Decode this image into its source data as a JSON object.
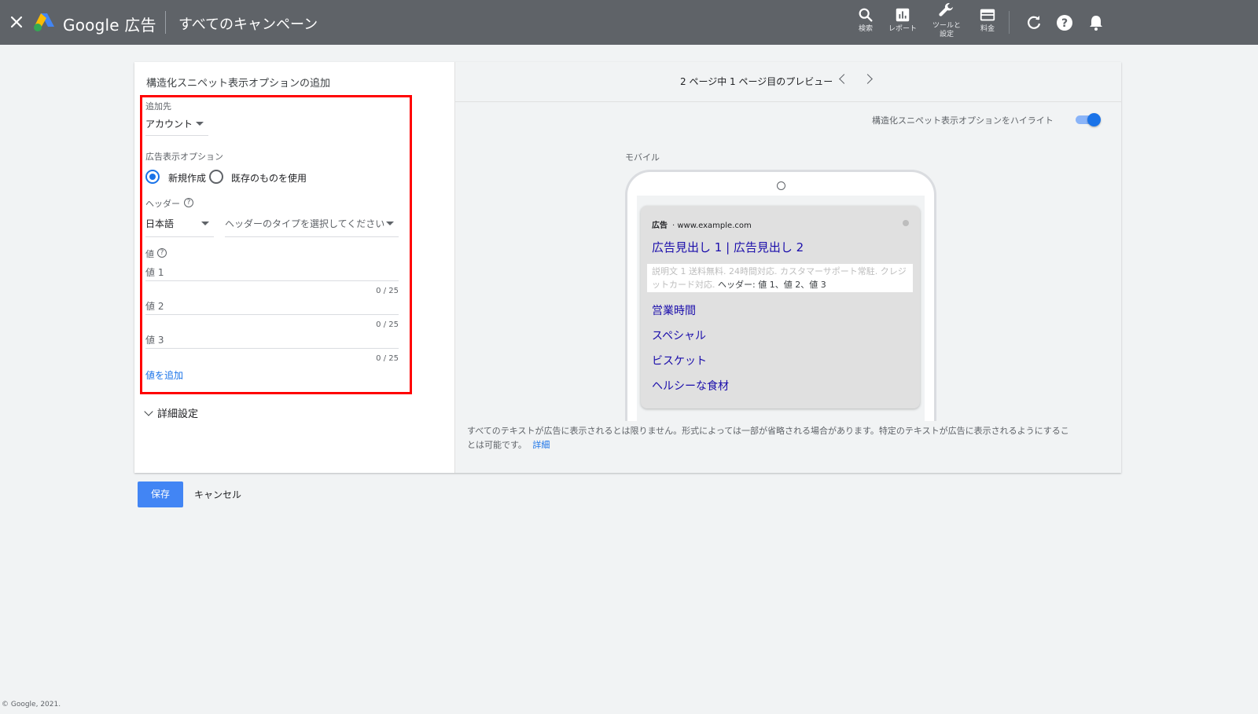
{
  "topbar": {
    "brand": "Google 広告",
    "title": "すべてのキャンペーン",
    "actions": [
      {
        "label": "検索",
        "icon": "search-icon"
      },
      {
        "label": "レポート",
        "icon": "reports-icon"
      },
      {
        "label_line1": "ツールと",
        "label_line2": "設定",
        "icon": "wrench-icon"
      },
      {
        "label": "料金",
        "icon": "billing-icon"
      }
    ]
  },
  "form": {
    "title": "構造化スニペット表示オプションの追加",
    "add_to": {
      "label": "追加先",
      "value": "アカウント"
    },
    "ad_extension": {
      "label": "広告表示オプション",
      "options": [
        "新規作成",
        "既存のものを使用"
      ],
      "selected": "新規作成"
    },
    "header": {
      "label": "ヘッダー",
      "language": "日本語",
      "type_placeholder": "ヘッダーのタイプを選択してください"
    },
    "values": {
      "label": "値",
      "items": [
        {
          "placeholder": "値 1",
          "counter": "0 / 25"
        },
        {
          "placeholder": "値 2",
          "counter": "0 / 25"
        },
        {
          "placeholder": "値 3",
          "counter": "0 / 25"
        }
      ],
      "add_link": "値を追加"
    },
    "advanced": "詳細設定"
  },
  "preview": {
    "nav_text": "2 ページ中 1 ページ目のプレビュー",
    "highlight_label": "構造化スニペット表示オプションをハイライト",
    "highlight_on": true,
    "device_label": "モバイル",
    "ad": {
      "badge": "広告",
      "url": "· www.example.com",
      "headline": "広告見出し 1 | 広告見出し 2",
      "description": "説明文 1 送料無料. 24時間対応. カスタマーサポート常駐. クレジットカード対応.",
      "snippet": "ヘッダー: 値 1、値 2、値 3",
      "sitelinks": [
        "営業時間",
        "スペシャル",
        "ビスケット",
        "ヘルシーな食材"
      ]
    },
    "disclaimer_line1": "すべてのテキストが広告に表示されるとは限りません。形式によっては一部が省略される場合があります。特定のテキストが広告に表示されるようにするこ",
    "disclaimer_line2": "とは可能です。",
    "details_link": "詳細"
  },
  "footer": {
    "save": "保存",
    "cancel": "キャンセル",
    "copyright": "© Google, 2021."
  },
  "colors": {
    "topbar": "#5f6368",
    "accent": "#1a73e8",
    "highlight_border": "#ff0000",
    "save_button": "#4285f4"
  }
}
